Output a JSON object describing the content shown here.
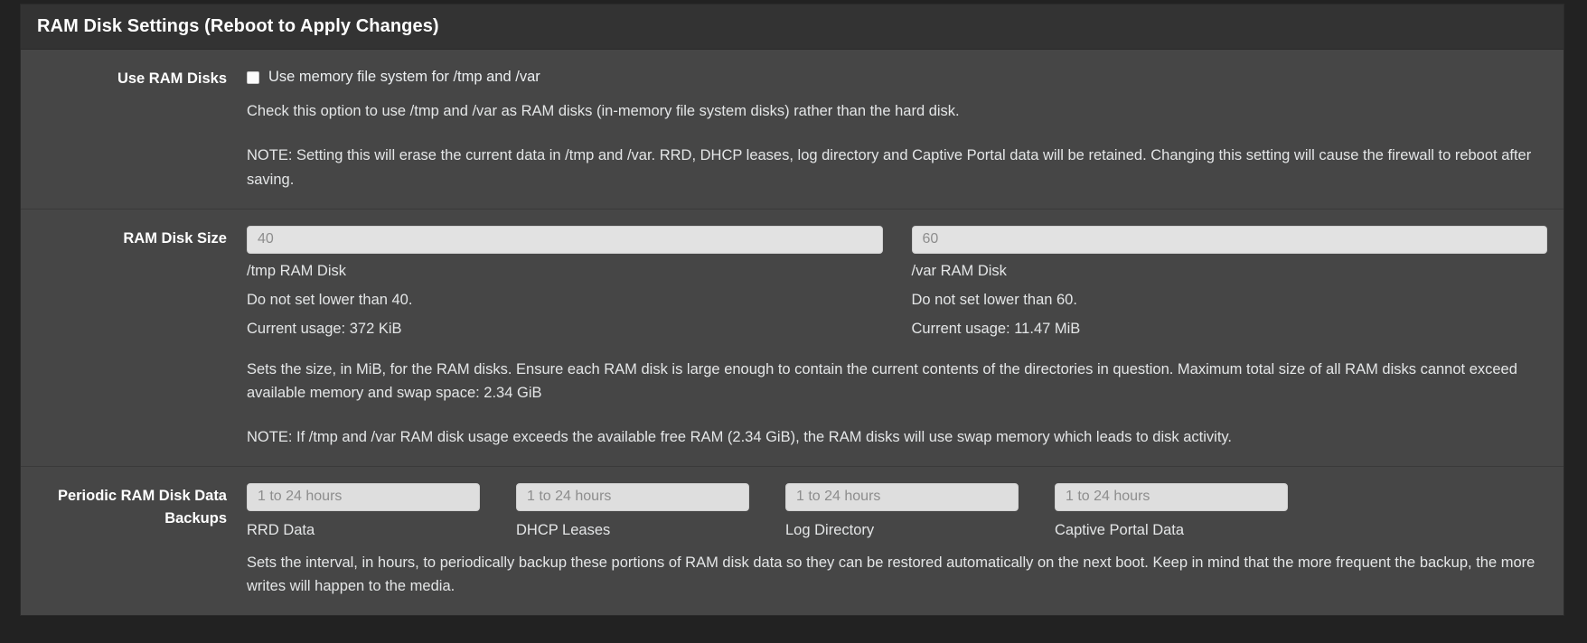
{
  "panel": {
    "title": "RAM Disk Settings (Reboot to Apply Changes)"
  },
  "theme": {
    "page_background": "#222222",
    "panel_background": "#464646",
    "panel_header_background": "#333333",
    "text_color": "#e4e6e7",
    "label_color": "#ffffff",
    "input_background": "#e2e2e2",
    "placeholder_color": "#8d8d8d"
  },
  "rows": {
    "use_ram_disks": {
      "label": "Use RAM Disks",
      "checkbox_label": "Use memory file system for /tmp and /var",
      "checkbox_checked": false,
      "help_1": "Check this option to use /tmp and /var as RAM disks (in-memory file system disks) rather than the hard disk.",
      "help_2": "NOTE: Setting this will erase the current data in /tmp and /var. RRD, DHCP leases, log directory and Captive Portal data will be retained. Changing this setting will cause the firewall to reboot after saving."
    },
    "ram_disk_size": {
      "label": "RAM Disk Size",
      "columns": [
        {
          "placeholder": "40",
          "value": "",
          "name": "/tmp RAM Disk",
          "minimum": "Do not set lower than 40.",
          "usage": "Current usage: 372 KiB"
        },
        {
          "placeholder": "60",
          "value": "",
          "name": "/var RAM Disk",
          "minimum": "Do not set lower than 60.",
          "usage": "Current usage: 11.47 MiB"
        }
      ],
      "help_1": "Sets the size, in MiB, for the RAM disks. Ensure each RAM disk is large enough to contain the current contents of the directories in question. Maximum total size of all RAM disks cannot exceed available memory and swap space: 2.34 GiB",
      "help_2": "NOTE: If /tmp and /var RAM disk usage exceeds the available free RAM (2.34 GiB), the RAM disks will use swap memory which leads to disk activity."
    },
    "periodic_backups": {
      "label": "Periodic RAM Disk Data Backups",
      "fields": [
        {
          "placeholder": "1 to 24 hours",
          "value": "",
          "caption": "RRD Data"
        },
        {
          "placeholder": "1 to 24 hours",
          "value": "",
          "caption": "DHCP Leases"
        },
        {
          "placeholder": "1 to 24 hours",
          "value": "",
          "caption": "Log Directory"
        },
        {
          "placeholder": "1 to 24 hours",
          "value": "",
          "caption": "Captive Portal Data"
        }
      ],
      "help_1": "Sets the interval, in hours, to periodically backup these portions of RAM disk data so they can be restored automatically on the next boot. Keep in mind that the more frequent the backup, the more writes will happen to the media."
    }
  }
}
